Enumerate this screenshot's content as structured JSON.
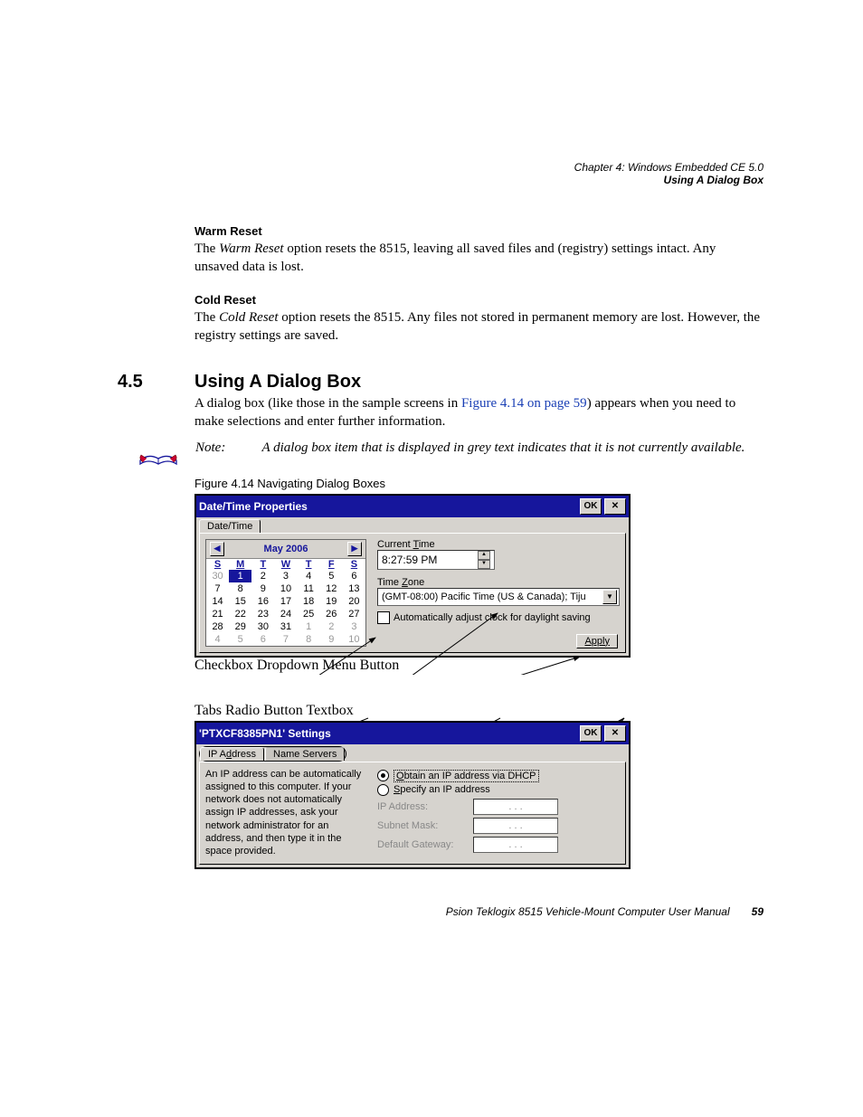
{
  "header": {
    "chapter": "Chapter 4: Windows Embedded CE 5.0",
    "section": "Using A Dialog Box"
  },
  "warm_reset": {
    "heading": "Warm Reset",
    "text_pre": "The ",
    "term": "Warm Reset",
    "text_post": " option resets the 8515, leaving all saved files and (registry) settings intact. Any unsaved data is lost."
  },
  "cold_reset": {
    "heading": "Cold Reset",
    "text_pre": "The ",
    "term": "Cold Reset",
    "text_post": " option resets the 8515. Any files not stored in permanent memory are lost. However, the registry settings are saved."
  },
  "sec45": {
    "num": "4.5",
    "title": "Using A Dialog Box",
    "para_pre": "A dialog box (like those in the sample screens in ",
    "link": "Figure 4.14 on page 59",
    "para_post": ") appears when you need to make selections and enter further information."
  },
  "note": {
    "label": "Note:",
    "text": "A dialog box item that is displayed in grey text indicates that it is not currently available."
  },
  "fig_caption": "Figure 4.14 Navigating Dialog Boxes",
  "dlg1": {
    "title": "Date/Time Properties",
    "ok": "OK",
    "tab": "Date/Time",
    "month": "May 2006",
    "dow": [
      "S",
      "M",
      "T",
      "W",
      "T",
      "F",
      "S"
    ],
    "weeks": [
      [
        {
          "d": "30",
          "dim": true
        },
        {
          "d": "1",
          "sel": true
        },
        {
          "d": "2"
        },
        {
          "d": "3"
        },
        {
          "d": "4"
        },
        {
          "d": "5"
        },
        {
          "d": "6"
        }
      ],
      [
        {
          "d": "7"
        },
        {
          "d": "8"
        },
        {
          "d": "9"
        },
        {
          "d": "10"
        },
        {
          "d": "11"
        },
        {
          "d": "12"
        },
        {
          "d": "13"
        }
      ],
      [
        {
          "d": "14"
        },
        {
          "d": "15"
        },
        {
          "d": "16"
        },
        {
          "d": "17"
        },
        {
          "d": "18"
        },
        {
          "d": "19"
        },
        {
          "d": "20"
        }
      ],
      [
        {
          "d": "21"
        },
        {
          "d": "22"
        },
        {
          "d": "23"
        },
        {
          "d": "24"
        },
        {
          "d": "25"
        },
        {
          "d": "26"
        },
        {
          "d": "27"
        }
      ],
      [
        {
          "d": "28"
        },
        {
          "d": "29"
        },
        {
          "d": "30"
        },
        {
          "d": "31"
        },
        {
          "d": "1",
          "dim": true
        },
        {
          "d": "2",
          "dim": true
        },
        {
          "d": "3",
          "dim": true
        }
      ],
      [
        {
          "d": "4",
          "dim": true
        },
        {
          "d": "5",
          "dim": true
        },
        {
          "d": "6",
          "dim": true
        },
        {
          "d": "7",
          "dim": true
        },
        {
          "d": "8",
          "dim": true
        },
        {
          "d": "9",
          "dim": true
        },
        {
          "d": "10",
          "dim": true
        }
      ]
    ],
    "current_time_label": "Current Time",
    "time_value": "8:27:59 PM",
    "tz_label": "Time Zone",
    "tz_value": "(GMT-08:00) Pacific Time (US & Canada); Tiju",
    "dst_label": "Automatically adjust clock for daylight saving",
    "apply": "Apply"
  },
  "callouts1": {
    "checkbox": "Checkbox",
    "dropdown": "Dropdown Menu",
    "button": "Button"
  },
  "callouts2": {
    "tabs": "Tabs",
    "radio": "Radio Button",
    "textbox": "Textbox"
  },
  "dlg2": {
    "title": "'PTXCF8385PN1' Settings",
    "ok": "OK",
    "tab1": "IP Address",
    "tab2": "Name Servers",
    "desc": "An IP address can be automatically assigned to this computer.  If your network does not automatically assign IP addresses, ask your network administrator for an address, and then type it in the space provided.",
    "radio1": "Obtain an IP address via DHCP",
    "radio2": "Specify an IP address",
    "ip_label": "IP Address:",
    "subnet_label": "Subnet Mask:",
    "gw_label": "Default Gateway:",
    "ip_dots": ".   .   ."
  },
  "footer": {
    "title": "Psion Teklogix 8515 Vehicle-Mount Computer User Manual",
    "page": "59"
  }
}
